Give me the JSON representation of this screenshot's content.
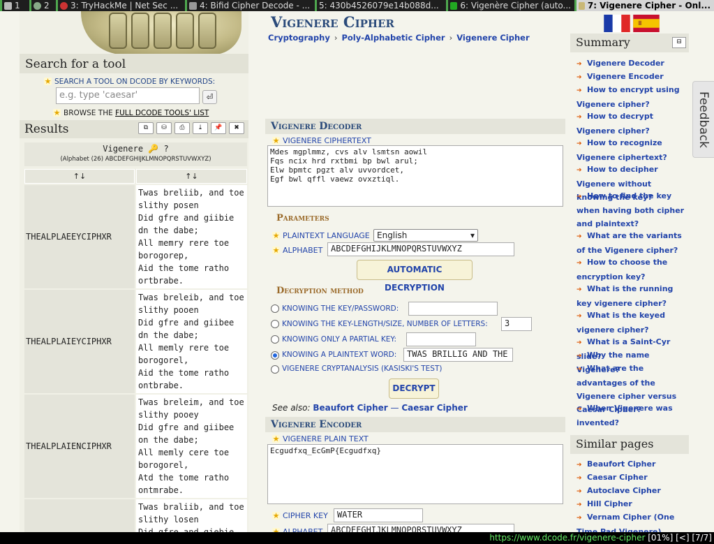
{
  "tabs": [
    {
      "label": "1",
      "active": false
    },
    {
      "label": "2",
      "active": false
    },
    {
      "label": "3: TryHackMe | Net Sec ...",
      "active": false
    },
    {
      "label": "4: Bifid Cipher Decode - ...",
      "active": false
    },
    {
      "label": "5: 430b4526079e14b088d...",
      "active": false
    },
    {
      "label": "6: Vigenère Cipher (auto...",
      "active": false
    },
    {
      "label": "7: Vigenere Cipher - Onl...",
      "active": true
    }
  ],
  "left": {
    "search_heading": "Search for a tool",
    "keywords_label": "SEARCH A TOOL ON DCODE BY KEYWORDS:",
    "search_placeholder": "e.g. type 'caesar'",
    "search_button": "⏎",
    "browse_prefix": "BROWSE THE",
    "browse_link": "FULL DCODE TOOLS' LIST",
    "results_heading": "Results",
    "results_buttons": [
      "⧉",
      "⛁",
      "⎙",
      "⤓",
      "📌",
      "✖"
    ],
    "results_title": "Vigenere 🔑 ?",
    "results_alphabet": "(Alphabet (26) ABCDEFGHIJKLMNOPQRSTUVWXYZ)",
    "sort_labels": [
      "↑↓",
      "↑↓"
    ],
    "rows": [
      {
        "key": "THEALPLAEEYCIPHXR",
        "text": "Twas breliib, and toe\nslithy posen\nDid gfre and giibie\ndn the dabe;\nAll memry rere toe\nborogorep,\nAid the tome ratho\nortbrabe."
      },
      {
        "key": "THEALPLAIEYCIPHXR",
        "text": "Twas breleib, and toe\nslithy pooen\nDid gfre and giibee\ndn the dabe;\nAll memly rere toe\nborogorel,\nAid the tome ratho\nontbrabe."
      },
      {
        "key": "THEALPLAIENCIPHXR",
        "text": "Twas breleim, and toe\nslithy pooey\nDid gfre and giibee\non the dabe;\nAll memly cere toe\nborogorel,\nAtd the tome ratho\nontmrabe."
      },
      {
        "key": "",
        "text": "Twas braliib, and toe\nslithy losen\nDid gfre and giebie"
      }
    ]
  },
  "main": {
    "title": "Vigenere Cipher",
    "breadcrumbs": [
      "Cryptography",
      "Poly-Alphabetic Cipher",
      "Vigenere Cipher"
    ],
    "decoder_heading": "Vigenere Decoder",
    "ciphertext_label": "VIGENERE CIPHERTEXT",
    "ciphertext": "Mdes mgplmmz, cvs alv lsmtsn aowil\nFqs ncix hrd rxtbmi bp bwl arul;\nElw bpmtc pgzt alv uvvordcet,\nEgf bwl qffl vaewz ovxztiql.",
    "parameters_heading": "Parameters",
    "plaintext_language_label": "PLAINTEXT LANGUAGE",
    "plaintext_language": "English",
    "alphabet_label": "ALPHABET",
    "alphabet": "ABCDEFGHIJKLMNOPQRSTUVWXYZ",
    "auto_button": "AUTOMATIC DECRYPTION",
    "method_heading": "Decryption method",
    "methods": [
      {
        "label": "KNOWING THE KEY/PASSWORD:",
        "value": "",
        "selected": false
      },
      {
        "label": "KNOWING THE KEY-LENGTH/SIZE, NUMBER OF LETTERS:",
        "value": "3",
        "selected": false
      },
      {
        "label": "KNOWING ONLY A PARTIAL KEY:",
        "value": "",
        "selected": false
      },
      {
        "label": "KNOWING A PLAINTEXT WORD:",
        "value": "TWAS BRILLIG AND THE",
        "selected": true
      },
      {
        "label": "VIGENERE CRYPTANALYSIS (KASISKI'S TEST)",
        "value": "",
        "selected": false
      }
    ],
    "decrypt_button": "DECRYPT",
    "see_also_label": "See also:",
    "see_also_links": [
      "Beaufort Cipher",
      "Caesar Cipher"
    ],
    "see_also_sep": "—",
    "encoder_heading": "Vigenere Encoder",
    "plaintext_label": "VIGENERE PLAIN TEXT",
    "plaintext": "Ecgudfxq_EcGmP{Ecgudfxq}",
    "cipher_key_label": "CIPHER KEY",
    "cipher_key": "WATER",
    "alphabet2_label": "ALPHABET",
    "alphabet2": "ABCDEFGHIJKLMNOPQRSTUVWXYZ"
  },
  "right": {
    "summary_heading": "Summary",
    "summary_button": "⊟",
    "summary_links": [
      "Vigenere Decoder",
      "Vigenere Encoder",
      "How to encrypt using Vigenere cipher?",
      "How to decrypt Vigenere cipher?",
      "How to recognize Vigenere ciphertext?",
      "How to decipher Vigenere without knowing the key?",
      "How to find the key when having both cipher and plaintext?",
      "What are the variants of the Vigenere cipher?",
      "How to choose the encryption key?",
      "What is the running key vigenere cipher?",
      "What is the keyed vigenere cipher?",
      "What is a Saint-Cyr slide?",
      "Why the name Vigenere?",
      "What are the advantages of the Vigenere cipher versus Caesar Cipher?",
      "When Vigenere was invented?"
    ],
    "similar_heading": "Similar pages",
    "similar_links": [
      "Beaufort Cipher",
      "Caesar Cipher",
      "Autoclave Cipher",
      "Hill Cipher",
      "Vernam Cipher (One Time Pad Vigenere)"
    ]
  },
  "feedback": "Feedback",
  "status": {
    "url": "https://www.dcode.fr/vigenere-cipher",
    "info": "[01%]  [<]  [7/7]"
  },
  "colors": {
    "link": "#2244aa",
    "heading": "#2a4a7a",
    "section_bg": "#e4e4da",
    "tabbar": "#1e1e1e",
    "status_url": "#66ee66"
  }
}
